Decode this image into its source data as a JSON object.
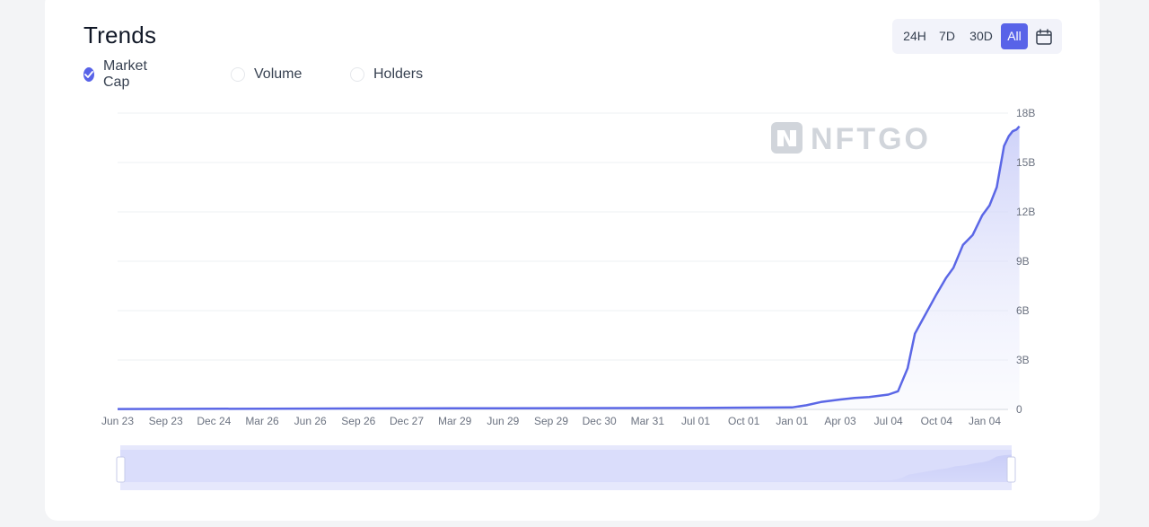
{
  "header": {
    "title": "Trends"
  },
  "toggles": [
    {
      "label": "Market Cap",
      "checked": true
    },
    {
      "label": "Volume",
      "checked": false
    },
    {
      "label": "Holders",
      "checked": false
    }
  ],
  "range_buttons": [
    {
      "label": "24H",
      "active": false
    },
    {
      "label": "7D",
      "active": false
    },
    {
      "label": "30D",
      "active": false
    },
    {
      "label": "All",
      "active": true
    }
  ],
  "watermark": "NFTGO",
  "colors": {
    "accent": "#5863e8",
    "line": "#5b67e6",
    "fill": "#dde0fb"
  },
  "chart_data": {
    "type": "area",
    "x_ticks": [
      "Jun 23",
      "Sep 23",
      "Dec 24",
      "Mar 26",
      "Jun 26",
      "Sep 26",
      "Dec 27",
      "Mar 29",
      "Jun 29",
      "Sep 29",
      "Dec 30",
      "Mar 31",
      "Jul 01",
      "Oct 01",
      "Jan 01",
      "Apr 03",
      "Jul 04",
      "Oct 04",
      "Jan 04"
    ],
    "y_ticks": [
      "0",
      "3B",
      "6B",
      "9B",
      "12B",
      "15B",
      "18B"
    ],
    "ylim": [
      0,
      18
    ],
    "y_unit": "B",
    "series": [
      {
        "x": [
          0,
          4,
          8,
          12,
          14,
          14.3,
          14.6,
          15,
          15.3,
          15.6,
          16,
          16.2,
          16.4,
          16.55,
          16.7,
          16.85,
          17.0,
          17.2,
          17.35,
          17.55,
          17.75,
          17.95,
          18.1,
          18.25,
          18.4,
          18.5,
          18.58,
          18.66,
          18.72
        ],
        "y": [
          0.02,
          0.05,
          0.07,
          0.09,
          0.12,
          0.25,
          0.45,
          0.6,
          0.7,
          0.75,
          0.9,
          1.1,
          2.5,
          4.6,
          5.4,
          6.2,
          7.0,
          8.0,
          8.6,
          10.0,
          10.6,
          11.8,
          12.4,
          13.5,
          16.0,
          16.6,
          16.9,
          17.0,
          17.2
        ]
      }
    ],
    "grid": true,
    "y_axis_position": "right",
    "legend": "none"
  }
}
